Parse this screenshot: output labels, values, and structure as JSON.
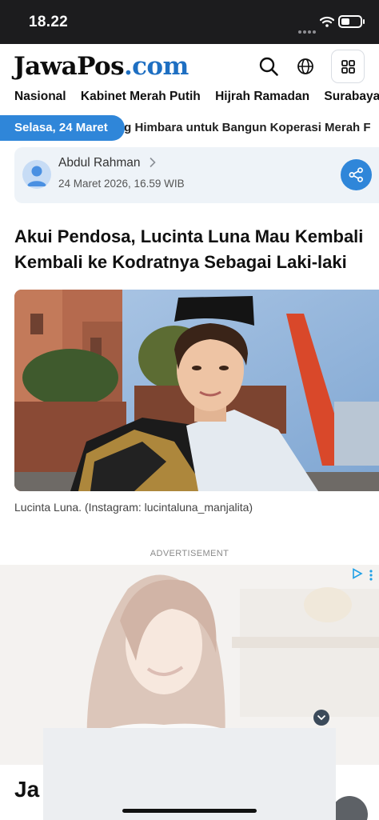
{
  "status_bar": {
    "time": "18.22"
  },
  "header": {
    "logo_main": "JawaPos",
    "logo_suffix": ".com"
  },
  "nav": {
    "items": [
      {
        "label": "Nasional"
      },
      {
        "label": "Kabinet Merah Putih"
      },
      {
        "label": "Hijrah Ramadan"
      },
      {
        "label": "Surabaya R"
      }
    ]
  },
  "ticker": {
    "date": "Selasa, 24 Maret",
    "headline": "ng Himbara untuk Bangun Koperasi Merah F"
  },
  "author": {
    "name": "Abdul Rahman",
    "published": "24 Maret 2026, 16.59 WIB"
  },
  "article": {
    "title": "Akui Pendosa, Lucinta Luna Mau Kembali Kembali ke Kodratnya Sebagai Laki-laki",
    "image_caption": "Lucinta Luna. (Instagram: lucintaluna_manjalita)"
  },
  "ad": {
    "label": "ADVERTISEMENT"
  },
  "next_section": {
    "heading": "Ja"
  },
  "colors": {
    "accent": "#2f86d9",
    "logo_com": "#1e6fc2",
    "status_bar": "#1c1c1e"
  },
  "icons": [
    "wifi-icon",
    "battery-icon",
    "search-icon",
    "globe-icon",
    "grid-menu-icon",
    "chevron-right-icon",
    "share-icon",
    "ad-choices-icon",
    "kebab-icon",
    "chevron-down-icon"
  ]
}
